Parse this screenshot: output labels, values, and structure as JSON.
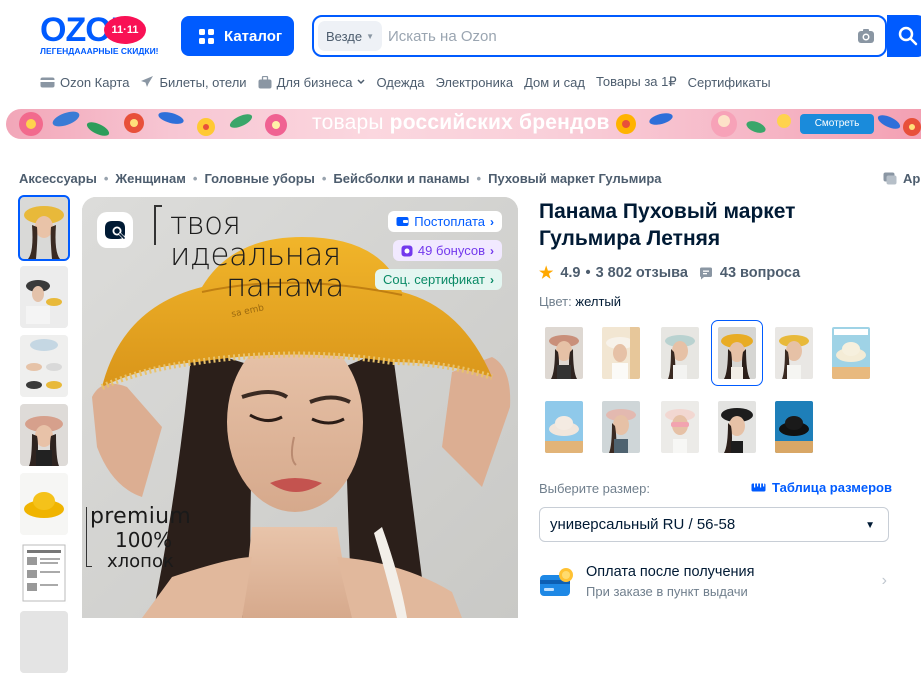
{
  "header": {
    "logo_text": "OZON",
    "logo_badge": "11·11",
    "logo_tagline": "ЛЕГЕНДАААРНЫЕ СКИДКИ!",
    "catalog_label": "Каталог",
    "search_scope": "Везде",
    "search_placeholder": "Искать на Ozon"
  },
  "nav": {
    "items": [
      {
        "label": "Ozon Карта",
        "icon": "card-icon"
      },
      {
        "label": "Билеты, отели",
        "icon": "plane-icon"
      },
      {
        "label": "Для бизнеса",
        "icon": "briefcase-icon",
        "has_dropdown": true
      },
      {
        "label": "Одежда"
      },
      {
        "label": "Электроника"
      },
      {
        "label": "Дом и сад"
      },
      {
        "label": "Товары за 1₽"
      },
      {
        "label": "Сертификаты"
      }
    ]
  },
  "banner": {
    "text_light": "товары ",
    "text_bold": "российских брендов",
    "button_label": "Смотреть"
  },
  "breadcrumb": [
    "Аксессуары",
    "Женщинам",
    "Головные уборы",
    "Бейсболки и панамы",
    "Пуховый маркет Гульмира"
  ],
  "ar_label": "Ар",
  "gallery": {
    "thumb_count": 7,
    "active_thumb": 0,
    "image_headline_1": "твоя идеальная",
    "image_headline_2": "панама",
    "image_premium_1": "premium",
    "image_premium_2": "100%",
    "image_premium_3": "хлопок",
    "badges": [
      {
        "label": "Постоплата",
        "icon": "wallet-icon",
        "color": "#005bff"
      },
      {
        "label": "49 бонусов",
        "icon": "bonus-icon",
        "color": "#7339ed"
      },
      {
        "label": "Соц. сертификат",
        "color": "#0a8a66"
      }
    ]
  },
  "product": {
    "title": "Панама Пуховый маркет Гульмира Летняя",
    "rating": "4.9",
    "reviews": "3 802 отзыва",
    "questions": "43 вопроса",
    "color_label": "Цвет:",
    "color_value": "желтый",
    "swatch_count": 11,
    "active_swatch": 3,
    "size_label": "Выберите размер:",
    "size_table_label": "Таблица размеров",
    "size_value": "универсальный RU / 56-58",
    "payment_title": "Оплата после получения",
    "payment_sub": "При заказе в пункт выдачи"
  },
  "colors": {
    "brand_blue": "#005bff",
    "brand_pink": "#f91155",
    "star": "#ffa800",
    "bonus_purple": "#7339ed",
    "cert_green": "#0a8a66"
  }
}
